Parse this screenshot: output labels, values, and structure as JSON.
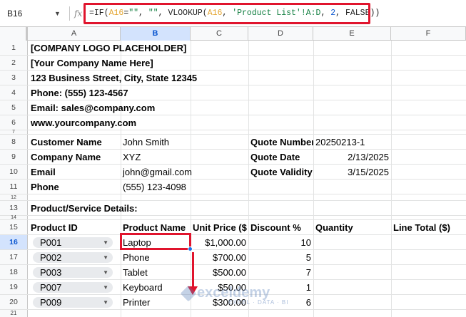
{
  "formula_bar": {
    "name_box": "B16",
    "caret": "▼",
    "fx": "fx",
    "formula": {
      "p1": "=IF(",
      "ref1": "A16",
      "p2": "=",
      "str1": "\"\"",
      "p3": ", ",
      "str2": "\"\"",
      "p4": ", VLOOKUP(",
      "ref2": "A16",
      "p5": ", ",
      "str3": "'Product List'!A:D",
      "p6": ", ",
      "num1": "2",
      "p7": ", FALSE))"
    }
  },
  "columns": [
    "A",
    "B",
    "C",
    "D",
    "E",
    "F"
  ],
  "rows": {
    "r1": {
      "num": "1",
      "a": "[COMPANY LOGO PLACEHOLDER]"
    },
    "r2": {
      "num": "2",
      "a": "[Your Company Name Here]"
    },
    "r3": {
      "num": "3",
      "a": "123 Business Street, City, State 12345"
    },
    "r4": {
      "num": "4",
      "a": "Phone: (555) 123-4567"
    },
    "r5": {
      "num": "5",
      "a": "Email: sales@company.com"
    },
    "r6": {
      "num": "6",
      "a": "www.yourcompany.com"
    },
    "r7": {
      "num": "7"
    },
    "r8": {
      "num": "8",
      "a": "Customer Name",
      "b": "John Smith",
      "d": "Quote Number",
      "e": "20250213-1"
    },
    "r9": {
      "num": "9",
      "a": "Company Name",
      "b": "XYZ",
      "d": "Quote Date",
      "e": "2/13/2025"
    },
    "r10": {
      "num": "10",
      "a": "Email",
      "b": "john@gmail.com",
      "d": "Quote Validity",
      "e": "3/15/2025"
    },
    "r11": {
      "num": "11",
      "a": "Phone",
      "b": "(555) 123-4098"
    },
    "r12": {
      "num": "12"
    },
    "r13": {
      "num": "13",
      "a": "Product/Service Details:"
    },
    "r14": {
      "num": "14"
    },
    "r15": {
      "num": "15",
      "a": "Product ID",
      "b": "Product Name",
      "c": "Unit Price ($",
      "d": "Discount %",
      "e": "Quantity",
      "f": "Line Total ($)"
    },
    "r16": {
      "num": "16",
      "a": "P001",
      "b": "Laptop",
      "c": "$1,000.00",
      "d": "10"
    },
    "r17": {
      "num": "17",
      "a": "P002",
      "b": "Phone",
      "c": "$700.00",
      "d": "5"
    },
    "r18": {
      "num": "18",
      "a": "P003",
      "b": "Tablet",
      "c": "$500.00",
      "d": "7"
    },
    "r19": {
      "num": "19",
      "a": "P007",
      "b": "Keyboard",
      "c": "$50.00",
      "d": "1"
    },
    "r20": {
      "num": "20",
      "a": "P009",
      "b": "Printer",
      "c": "$300.00",
      "d": "6"
    },
    "r21": {
      "num": "21"
    }
  },
  "chip_caret": "▼",
  "watermark": {
    "brand": "exceldemy",
    "sub": "EXCEL · DATA · BI"
  },
  "colors": {
    "accent": "#1a73e8",
    "annotation": "#e0142d",
    "header_bg": "#f8f9fa",
    "selected_header": "#d3e3fd"
  }
}
